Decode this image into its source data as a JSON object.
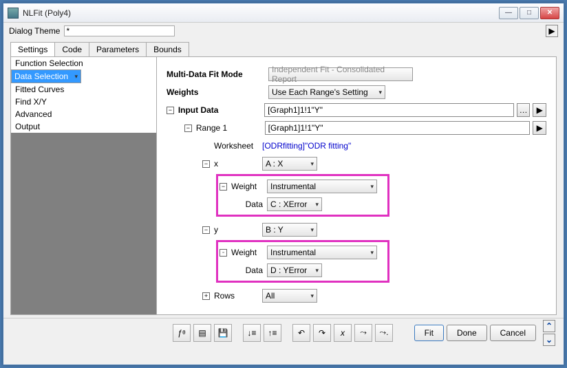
{
  "window": {
    "title": "NLFit (Poly4)"
  },
  "theme": {
    "label": "Dialog Theme",
    "value": "*"
  },
  "tabs": [
    "Settings",
    "Code",
    "Parameters",
    "Bounds"
  ],
  "sidebar": {
    "items": [
      "Function Selection",
      "Data Selection",
      "Fitted Curves",
      "Find X/Y",
      "Advanced",
      "Output"
    ],
    "selected": 1
  },
  "form": {
    "multiMode": {
      "label": "Multi-Data Fit Mode",
      "value": "Independent Fit - Consolidated Report"
    },
    "weights": {
      "label": "Weights",
      "value": "Use Each Range's Setting"
    },
    "inputData": {
      "label": "Input Data",
      "value": "[Graph1]1!1\"Y\""
    },
    "range1": {
      "label": "Range 1",
      "value": "[Graph1]1!1\"Y\""
    },
    "worksheet": {
      "label": "Worksheet",
      "value": "[ODRfitting]\"ODR fitting\""
    },
    "x": {
      "label": "x",
      "value": "A : X"
    },
    "xWeight": {
      "label": "Weight",
      "value": "Instrumental"
    },
    "xData": {
      "label": "Data",
      "value": "C : XError"
    },
    "y": {
      "label": "y",
      "value": "B : Y"
    },
    "yWeight": {
      "label": "Weight",
      "value": "Instrumental"
    },
    "yData": {
      "label": "Data",
      "value": "D : YError"
    },
    "rows": {
      "label": "Rows",
      "value": "All"
    }
  },
  "buttons": {
    "fit": "Fit",
    "done": "Done",
    "cancel": "Cancel"
  }
}
